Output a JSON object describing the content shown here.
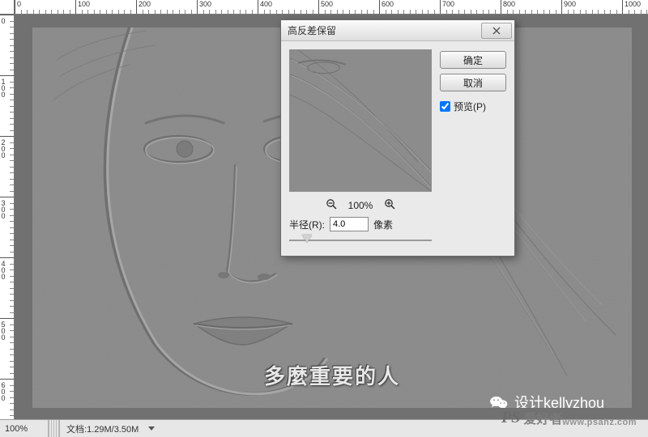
{
  "ruler": {
    "h_majors": [
      0,
      100,
      200,
      300,
      400,
      500,
      600,
      700,
      800,
      900,
      1000
    ],
    "v_majors": [
      0,
      100,
      200,
      300,
      400,
      500,
      600
    ]
  },
  "status": {
    "zoom": "100%",
    "doc_info_label": "文档:",
    "doc_info_value": "1.29M/3.50M"
  },
  "image": {
    "caption": "多麼重要的人",
    "credit_prefix": "设计",
    "credit_name": "kellyzhou"
  },
  "dialog": {
    "title": "高反差保留",
    "ok": "确定",
    "cancel": "取消",
    "preview_label": "预览(P)",
    "preview_checked": true,
    "zoom_value": "100%",
    "radius_label": "半径(R):",
    "radius_value": "4.0",
    "radius_unit": "像素"
  },
  "watermark": {
    "brand": "PS",
    "text": "爱好者",
    "url": "www.psahz.com"
  }
}
